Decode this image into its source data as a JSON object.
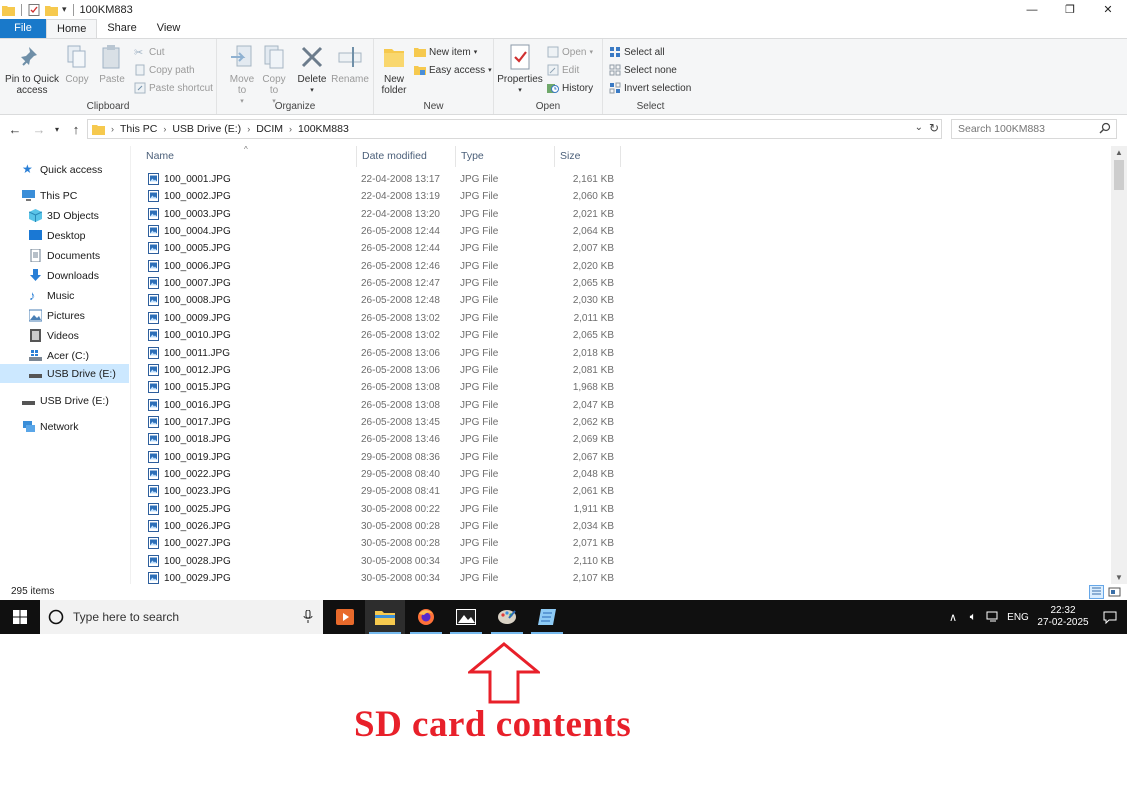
{
  "window": {
    "title": "100KM883",
    "controls": {
      "minimize": "—",
      "restore": "❐",
      "close": "✕"
    }
  },
  "ribbon_tabs": [
    "File",
    "Home",
    "Share",
    "View"
  ],
  "ribbon": {
    "clipboard": {
      "label": "Clipboard",
      "pin": "Pin to Quick access",
      "copy": "Copy",
      "paste": "Paste",
      "cut": "Cut",
      "copy_path": "Copy path",
      "paste_shortcut": "Paste shortcut"
    },
    "organize": {
      "label": "Organize",
      "move_to": "Move to",
      "copy_to": "Copy to",
      "delete": "Delete",
      "rename": "Rename"
    },
    "new": {
      "label": "New",
      "new_folder": "New folder",
      "new_item": "New item",
      "easy_access": "Easy access"
    },
    "open": {
      "label": "Open",
      "properties": "Properties",
      "open": "Open",
      "edit": "Edit",
      "history": "History"
    },
    "select": {
      "label": "Select",
      "select_all": "Select all",
      "select_none": "Select none",
      "invert": "Invert selection"
    }
  },
  "address": {
    "crumbs": [
      "This PC",
      "USB Drive (E:)",
      "DCIM",
      "100KM883"
    ],
    "search_placeholder": "Search 100KM883"
  },
  "nav": {
    "quick_access": "Quick access",
    "this_pc": "This PC",
    "objects": "3D Objects",
    "desktop": "Desktop",
    "documents": "Documents",
    "downloads": "Downloads",
    "music": "Music",
    "pictures": "Pictures",
    "videos": "Videos",
    "acer": "Acer (C:)",
    "usb_sub": "USB Drive (E:)",
    "usb": "USB Drive (E:)",
    "network": "Network"
  },
  "columns": {
    "name": "Name",
    "date": "Date modified",
    "type": "Type",
    "size": "Size"
  },
  "files": [
    {
      "name": "100_0001.JPG",
      "date": "22-04-2008 13:17",
      "type": "JPG File",
      "size": "2,161 KB"
    },
    {
      "name": "100_0002.JPG",
      "date": "22-04-2008 13:19",
      "type": "JPG File",
      "size": "2,060 KB"
    },
    {
      "name": "100_0003.JPG",
      "date": "22-04-2008 13:20",
      "type": "JPG File",
      "size": "2,021 KB"
    },
    {
      "name": "100_0004.JPG",
      "date": "26-05-2008 12:44",
      "type": "JPG File",
      "size": "2,064 KB"
    },
    {
      "name": "100_0005.JPG",
      "date": "26-05-2008 12:44",
      "type": "JPG File",
      "size": "2,007 KB"
    },
    {
      "name": "100_0006.JPG",
      "date": "26-05-2008 12:46",
      "type": "JPG File",
      "size": "2,020 KB"
    },
    {
      "name": "100_0007.JPG",
      "date": "26-05-2008 12:47",
      "type": "JPG File",
      "size": "2,065 KB"
    },
    {
      "name": "100_0008.JPG",
      "date": "26-05-2008 12:48",
      "type": "JPG File",
      "size": "2,030 KB"
    },
    {
      "name": "100_0009.JPG",
      "date": "26-05-2008 13:02",
      "type": "JPG File",
      "size": "2,011 KB"
    },
    {
      "name": "100_0010.JPG",
      "date": "26-05-2008 13:02",
      "type": "JPG File",
      "size": "2,065 KB"
    },
    {
      "name": "100_0011.JPG",
      "date": "26-05-2008 13:06",
      "type": "JPG File",
      "size": "2,018 KB"
    },
    {
      "name": "100_0012.JPG",
      "date": "26-05-2008 13:06",
      "type": "JPG File",
      "size": "2,081 KB"
    },
    {
      "name": "100_0015.JPG",
      "date": "26-05-2008 13:08",
      "type": "JPG File",
      "size": "1,968 KB"
    },
    {
      "name": "100_0016.JPG",
      "date": "26-05-2008 13:08",
      "type": "JPG File",
      "size": "2,047 KB"
    },
    {
      "name": "100_0017.JPG",
      "date": "26-05-2008 13:45",
      "type": "JPG File",
      "size": "2,062 KB"
    },
    {
      "name": "100_0018.JPG",
      "date": "26-05-2008 13:46",
      "type": "JPG File",
      "size": "2,069 KB"
    },
    {
      "name": "100_0019.JPG",
      "date": "29-05-2008 08:36",
      "type": "JPG File",
      "size": "2,067 KB"
    },
    {
      "name": "100_0022.JPG",
      "date": "29-05-2008 08:40",
      "type": "JPG File",
      "size": "2,048 KB"
    },
    {
      "name": "100_0023.JPG",
      "date": "29-05-2008 08:41",
      "type": "JPG File",
      "size": "2,061 KB"
    },
    {
      "name": "100_0025.JPG",
      "date": "30-05-2008 00:22",
      "type": "JPG File",
      "size": "1,911 KB"
    },
    {
      "name": "100_0026.JPG",
      "date": "30-05-2008 00:28",
      "type": "JPG File",
      "size": "2,034 KB"
    },
    {
      "name": "100_0027.JPG",
      "date": "30-05-2008 00:28",
      "type": "JPG File",
      "size": "2,071 KB"
    },
    {
      "name": "100_0028.JPG",
      "date": "30-05-2008 00:34",
      "type": "JPG File",
      "size": "2,110 KB"
    },
    {
      "name": "100_0029.JPG",
      "date": "30-05-2008 00:34",
      "type": "JPG File",
      "size": "2,107 KB"
    }
  ],
  "status": {
    "items": "295 items"
  },
  "taskbar": {
    "search_placeholder": "Type here to search",
    "lang": "ENG",
    "time": "22:32",
    "date": "27-02-2025"
  },
  "annotation": {
    "text": "SD card contents",
    "color": "#e8202a"
  },
  "colors": {
    "accent": "#1979ca",
    "selection": "#cce8ff",
    "taskbar": "#101010"
  }
}
